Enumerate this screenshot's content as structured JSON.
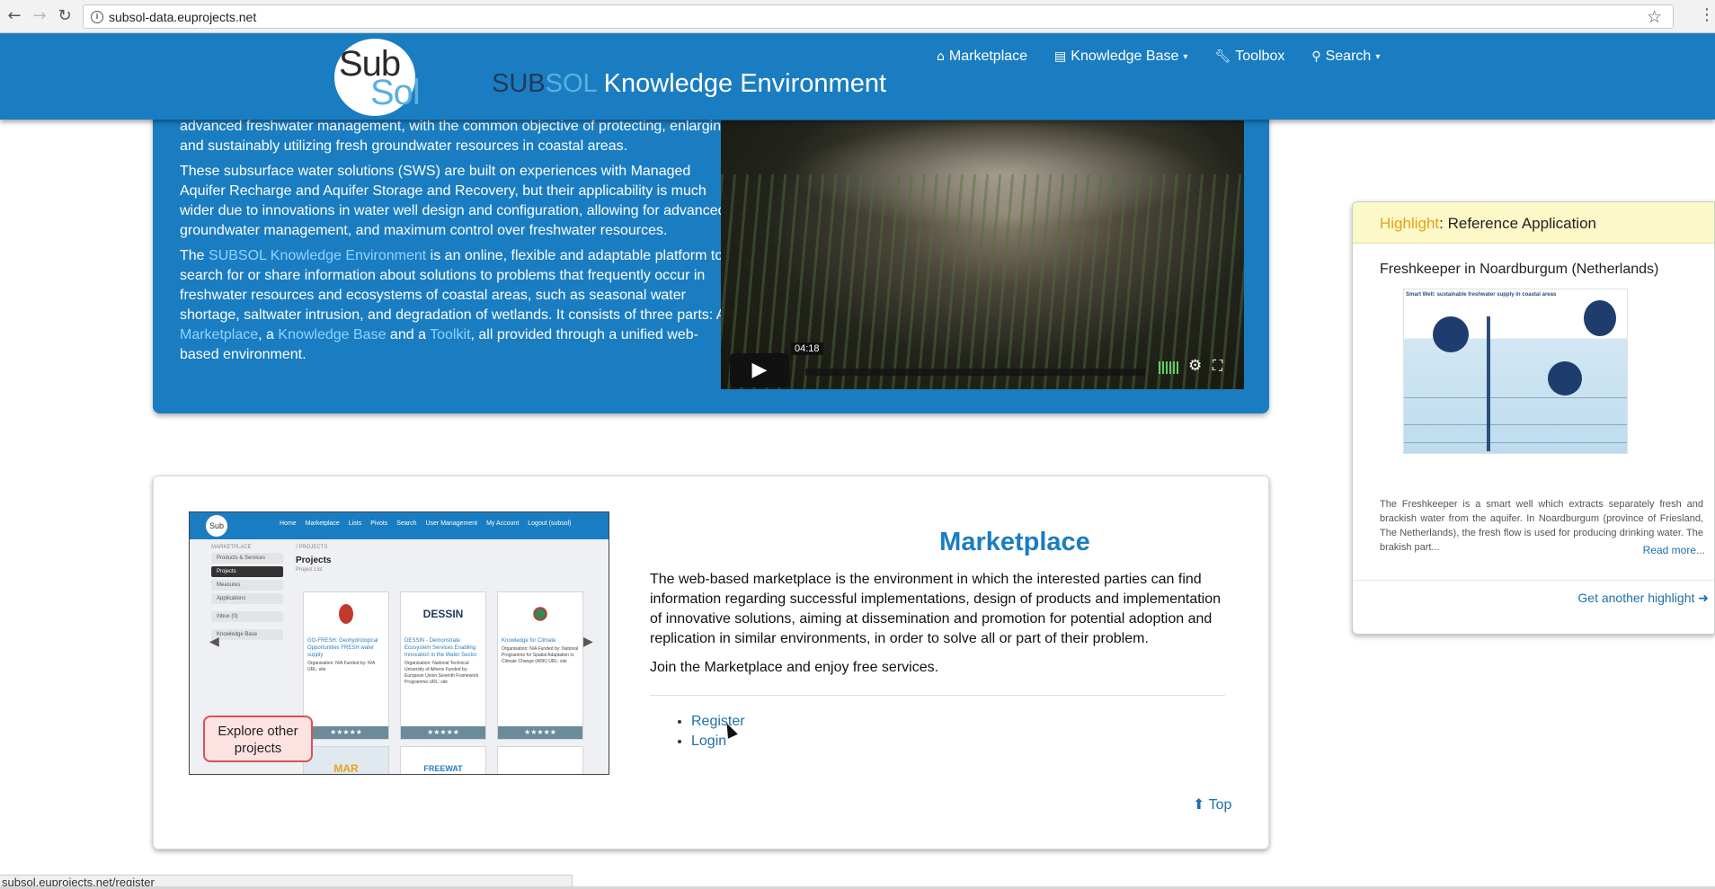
{
  "browser": {
    "url": "subsol-data.euprojects.net",
    "status_url": "subsol.euprojects.net/register"
  },
  "header": {
    "logo_line1": "Sub",
    "logo_line2": "Sol",
    "title_sub": "SUB",
    "title_sol": "SOL",
    "title_rest": " Knowledge Environment",
    "nav": [
      {
        "label": "Marketplace",
        "icon": "home-icon"
      },
      {
        "label": "Knowledge Base",
        "icon": "list-icon",
        "caret": true
      },
      {
        "label": "Toolbox",
        "icon": "wrench-icon"
      },
      {
        "label": "Search",
        "icon": "search-icon",
        "caret": true
      }
    ]
  },
  "intro": {
    "p1": "advanced freshwater management, with the common objective of protecting, enlarging and sustainably utilizing fresh groundwater resources in coastal areas.",
    "p2": "These subsurface water solutions (SWS) are built on experiences with Managed Aquifer Recharge and Aquifer Storage and Recovery, but their applicability is much wider due to innovations in water well design and configuration, allowing for advanced groundwater management, and maximum control over freshwater resources.",
    "p3_a": "The ",
    "p3_link": "SUBSOL Knowledge Environment",
    "p3_b": " is an online, flexible and adaptable platform to search for or share information about solutions to problems that frequently occur in freshwater resources and ecosystems of coastal areas, such as seasonal water shortage, saltwater intrusion, and degradation of wetlands. It consists of three parts: A ",
    "p3_mk": "Marketplace",
    "p3_c": ", a ",
    "p3_kb": "Knowledge Base",
    "p3_d": " and a ",
    "p3_tk": "Toolkit",
    "p3_e": ", all provided through a unified web-based environment.",
    "video_time": "04:18"
  },
  "market": {
    "heading": "Marketplace",
    "p1": "The web-based marketplace is the environment in which the interested parties can find information regarding successful implementations, design of products and implementation of innovative solutions, aiming at dissemination and promotion for potential adoption and replication in similar environments, in order to solve all or part of their problem.",
    "p2": "Join the Marketplace and enjoy free services.",
    "register": "Register",
    "login": "Login",
    "top": "Top",
    "callout": "Explore other projects",
    "shot": {
      "logo": "Sub",
      "nav": [
        "Home",
        "Marketplace",
        "Lists",
        "Pivots",
        "Search",
        "User Management",
        "My Account",
        "Logout (subsol)"
      ],
      "side_head": "MARKETPLACE",
      "side": [
        "Products & Services",
        "Projects",
        "Measures",
        "Applications",
        "Inbox (0)",
        "Knowledge Base"
      ],
      "crumb": "/ PROJECTS",
      "title": "Projects",
      "sub": "Project List",
      "cards": [
        {
          "pic": "",
          "title": "GO-FRESH: Geohydrological Opportunities FRESH water supply",
          "meta": "Organisation: N/A Funded by: N/A URL: site"
        },
        {
          "pic": "DESSIN",
          "title": "DESSIN - Demonstrate Ecosystem Services Enabling Innovation in the Water Sector",
          "meta": "Organisation: National Technical University of Athens Funded by: European Union Seventh Framework Programme URL: site"
        },
        {
          "pic": "",
          "title": "Knowledge for Climate",
          "meta": "Organisation: N/A Funded by: National Programme for Spatial Adaptation to Climate Change (ARK) URL: site"
        }
      ],
      "cards2": [
        "MAR",
        "FREEWAT",
        ""
      ],
      "stars": "★★★★★"
    }
  },
  "highlight": {
    "tag": "Highlight",
    "head": ": Reference Application",
    "title": "Freshkeeper in Noardburgum (Netherlands)",
    "img_caption": "Smart Well: sustainable freshwater supply in coastal areas",
    "desc": "The Freshkeeper is a smart well which extracts separately fresh and brackish water from the aquifer. In Noardburgum (province of Friesland, The Netherlands), the fresh flow is used for producing drinking water. The brakish part...",
    "more": "Read more...",
    "another": "Get another highlight"
  }
}
